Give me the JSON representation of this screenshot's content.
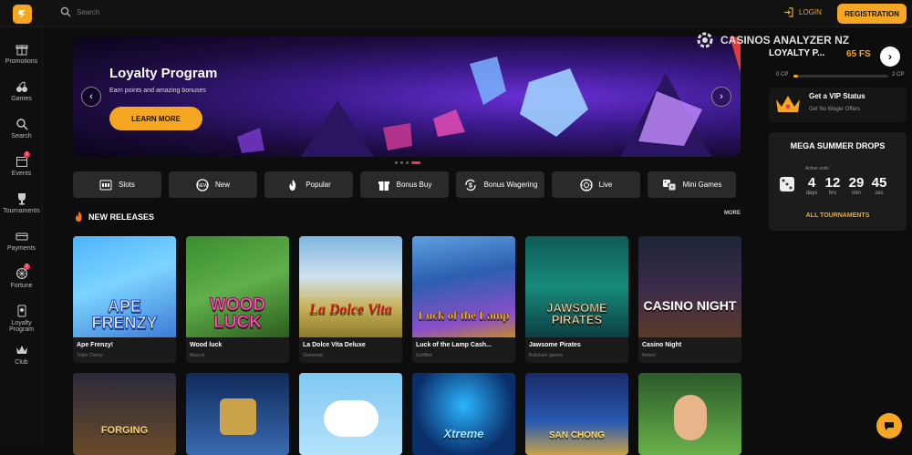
{
  "header": {
    "search_placeholder": "Search",
    "login_label": "LOGIN",
    "register_label": "REGISTRATION",
    "colors": {
      "accent": "#f5a623",
      "background": "#121212"
    }
  },
  "sidebar": {
    "items": [
      {
        "label": "Promotions",
        "icon": "gift-icon"
      },
      {
        "label": "Games",
        "icon": "cherries-icon"
      },
      {
        "label": "Search",
        "icon": "search-icon"
      },
      {
        "label": "Events",
        "icon": "calendar-icon",
        "badge": "1"
      },
      {
        "label": "Tournaments",
        "icon": "trophy-icon"
      },
      {
        "label": "Payments",
        "icon": "card-icon"
      },
      {
        "label": "Fortune",
        "icon": "wheel-icon",
        "badge": "1"
      },
      {
        "label": "Loyalty Program",
        "icon": "loyalty-icon"
      },
      {
        "label": "Club",
        "icon": "crown-icon"
      }
    ]
  },
  "hero": {
    "title": "Loyalty Program",
    "subtitle": "Earn points and amazing bonuses",
    "cta": "LEARN MORE",
    "slides_total": 4,
    "active_slide": 4
  },
  "categories": [
    {
      "label": "Slots",
      "icon": "slot-machine-icon"
    },
    {
      "label": "New",
      "icon": "new-icon"
    },
    {
      "label": "Popular",
      "icon": "fire-icon"
    },
    {
      "label": "Bonus Buy",
      "icon": "gift-icon"
    },
    {
      "label": "Bonus Wagering",
      "icon": "dollar-cycle-icon"
    },
    {
      "label": "Live",
      "icon": "chip-icon"
    },
    {
      "label": "Mini Games",
      "icon": "dice-icon"
    }
  ],
  "new_releases": {
    "heading": "NEW RELEASES",
    "more_label": "MORE",
    "games": [
      {
        "title": "Ape Frenzy!",
        "provider": "Triple Cherry",
        "art": "APE FRENZY"
      },
      {
        "title": "Wood luck",
        "provider": "Mascot",
        "art": "WOOD LUCK"
      },
      {
        "title": "La Dolce Vita Deluxe",
        "provider": "Gamomat",
        "art": "La Dolce Vita"
      },
      {
        "title": "Luck of the Lamp Cash...",
        "provider": "iSoftBet",
        "art": "Luck of the Lamp"
      },
      {
        "title": "Jawsome Pirates",
        "provider": "Bullshark games",
        "art": "JAWSOME PIRATES"
      },
      {
        "title": "Casino Night",
        "provider": "Netent",
        "art": "CASINO NIGHT"
      }
    ],
    "second_row": [
      {
        "art": "FORGING"
      },
      {
        "art": ""
      },
      {
        "art": ""
      },
      {
        "art": "Xtreme"
      },
      {
        "art": "SAN CHONG"
      },
      {
        "art": ""
      }
    ]
  },
  "watermark": "CASINOS ANALYZER NZ",
  "loyalty_panel": {
    "title": "LOYALTY P...",
    "fs": "65 FS",
    "cp_start": "0 CP",
    "cp_end": "2 CP",
    "progress": 0.05
  },
  "vip": {
    "title": "Get a VIP Status",
    "subtitle": "Get No Wager Offers"
  },
  "tournament": {
    "title": "MEGA SUMMER DROPS",
    "active_units_label": "Active units",
    "countdown": [
      {
        "value": "4",
        "unit": "days"
      },
      {
        "value": "12",
        "unit": "hrs"
      },
      {
        "value": "29",
        "unit": "min"
      },
      {
        "value": "45",
        "unit": "sec"
      }
    ],
    "all_label": "ALL TOURNAMENTS"
  }
}
